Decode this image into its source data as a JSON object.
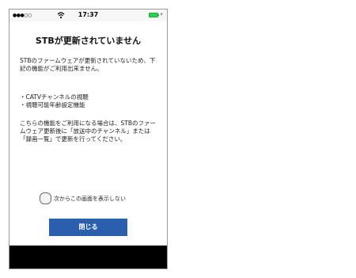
{
  "status_bar": {
    "signal": "●●●○○",
    "time": "17:37",
    "battery_color": "#2bd14a"
  },
  "dialog": {
    "title": "STBが更新されていません",
    "paragraph1": "STBのファームウェアが更新されていないため、下記の機能がご利用出来ません。",
    "features": "・CATVチャンネルの視聴\n・視聴可能年齢設定機能",
    "paragraph2": "こちらの機能をご利用になる場合は、STBのファームウェア更新後に「放送中のチャンネル」または「録画一覧」で更新を行ってください。",
    "checkbox_label": "次からこの画面を表示しない",
    "checkbox_checked": false,
    "close_button": "閉じる",
    "accent_color": "#2a5fae"
  }
}
